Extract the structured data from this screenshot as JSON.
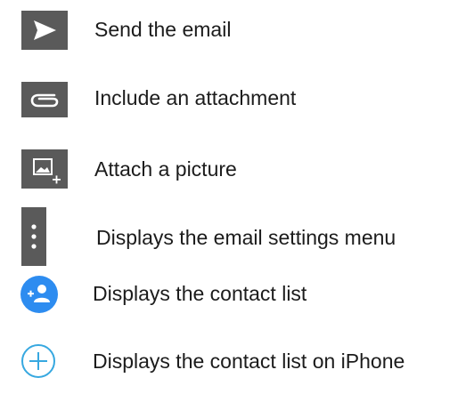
{
  "colors": {
    "icon_gray": "#5a5a5a",
    "icon_blue": "#2d8cf0",
    "outline_blue": "#37a8e0",
    "text": "#1c1c1c"
  },
  "items": [
    {
      "icon": "send-icon",
      "label": "Send the email"
    },
    {
      "icon": "paperclip-icon",
      "label": "Include an attachment"
    },
    {
      "icon": "add-picture-icon",
      "label": "Attach a picture"
    },
    {
      "icon": "more-vertical-icon",
      "label": "Displays the email settings menu"
    },
    {
      "icon": "add-contact-icon",
      "label": "Displays the contact list"
    },
    {
      "icon": "plus-circle-icon",
      "label": "Displays the contact list on iPhone"
    }
  ]
}
